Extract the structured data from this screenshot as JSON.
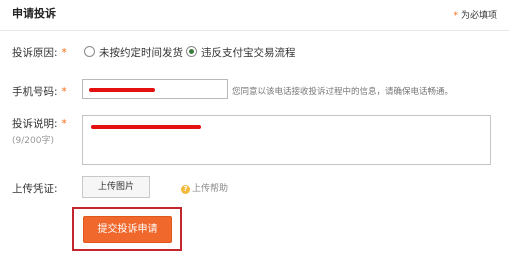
{
  "header": {
    "title": "申请投诉",
    "required_star": "*",
    "required_note": "为必填项"
  },
  "form": {
    "reason": {
      "label": "投诉原因:",
      "star": "*",
      "options": [
        {
          "label": "未按约定时间发货",
          "checked": false
        },
        {
          "label": "违反支付宝交易流程",
          "checked": true
        }
      ]
    },
    "phone": {
      "label": "手机号码:",
      "star": "*",
      "value_redacted": true,
      "hint": "您同意以该电话接收投诉过程中的信息，请确保电话畅通。"
    },
    "description": {
      "label": "投诉说明:",
      "star": "*",
      "char_count": "(9/200字)",
      "value_redacted": true
    },
    "upload": {
      "label": "上传凭证:",
      "button_label": "上传图片",
      "help_icon": "?",
      "help_label": "上传帮助"
    },
    "submit": {
      "label": "提交投诉申请"
    }
  },
  "colors": {
    "accent": "#f1682c",
    "required": "#f26b0f",
    "highlight_frame": "#c4262e",
    "redaction": "#e40f0f"
  }
}
